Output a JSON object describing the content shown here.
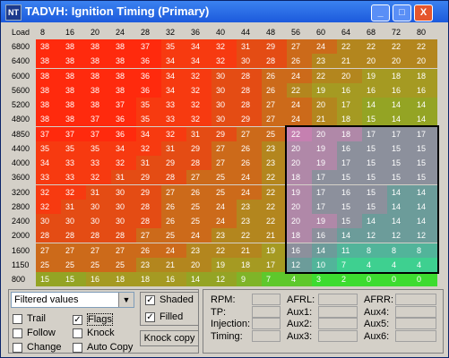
{
  "window": {
    "title": "TADVH: Ignition Timing (Primary)",
    "icon_label": "NT"
  },
  "titlebar_buttons": {
    "minimize": "_",
    "maximize": "□",
    "close": "X"
  },
  "header": {
    "corner": "Load",
    "columns": [
      "8",
      "16",
      "20",
      "24",
      "28",
      "32",
      "36",
      "40",
      "44",
      "48",
      "56",
      "60",
      "64",
      "68",
      "72",
      "80"
    ]
  },
  "rows": [
    {
      "rpm": "6800",
      "values": [
        38,
        38,
        38,
        38,
        37,
        35,
        34,
        32,
        31,
        29,
        27,
        24,
        22,
        22,
        22,
        22
      ]
    },
    {
      "rpm": "6400",
      "values": [
        38,
        38,
        38,
        38,
        36,
        34,
        34,
        32,
        30,
        28,
        26,
        23,
        21,
        20,
        20,
        20
      ]
    },
    {
      "rpm": "6000",
      "values": [
        38,
        38,
        38,
        38,
        36,
        34,
        32,
        30,
        28,
        26,
        24,
        22,
        20,
        19,
        18,
        18
      ]
    },
    {
      "rpm": "5600",
      "values": [
        38,
        38,
        38,
        38,
        36,
        34,
        32,
        30,
        28,
        26,
        22,
        19,
        16,
        16,
        16,
        16
      ]
    },
    {
      "rpm": "5200",
      "values": [
        38,
        38,
        38,
        37,
        35,
        33,
        32,
        30,
        28,
        27,
        24,
        20,
        17,
        14,
        14,
        14
      ]
    },
    {
      "rpm": "4800",
      "values": [
        38,
        38,
        37,
        36,
        35,
        33,
        32,
        30,
        29,
        27,
        24,
        21,
        18,
        15,
        14,
        14
      ]
    },
    {
      "rpm": "4850",
      "values": [
        37,
        37,
        37,
        36,
        34,
        32,
        31,
        29,
        27,
        25,
        22,
        20,
        18,
        17,
        17,
        17
      ]
    },
    {
      "rpm": "4400",
      "values": [
        35,
        35,
        35,
        34,
        32,
        31,
        29,
        27,
        26,
        23,
        20,
        19,
        16,
        15,
        15,
        15
      ]
    },
    {
      "rpm": "4000",
      "values": [
        34,
        33,
        33,
        32,
        31,
        29,
        28,
        27,
        26,
        23,
        20,
        19,
        17,
        15,
        15,
        15
      ]
    },
    {
      "rpm": "3600",
      "values": [
        33,
        33,
        32,
        31,
        29,
        28,
        27,
        25,
        24,
        22,
        18,
        17,
        15,
        15,
        15,
        15
      ]
    },
    {
      "rpm": "3200",
      "values": [
        32,
        32,
        31,
        30,
        29,
        27,
        26,
        25,
        24,
        22,
        19,
        17,
        16,
        15,
        14,
        14
      ]
    },
    {
      "rpm": "2800",
      "values": [
        32,
        31,
        30,
        30,
        28,
        26,
        25,
        24,
        23,
        22,
        20,
        17,
        15,
        15,
        14,
        14
      ]
    },
    {
      "rpm": "2400",
      "values": [
        30,
        30,
        30,
        30,
        28,
        26,
        25,
        24,
        23,
        22,
        20,
        19,
        15,
        14,
        14,
        14
      ]
    },
    {
      "rpm": "2000",
      "values": [
        28,
        28,
        28,
        28,
        27,
        25,
        24,
        23,
        22,
        21,
        18,
        16,
        14,
        12,
        12,
        12
      ]
    },
    {
      "rpm": "1600",
      "values": [
        27,
        27,
        27,
        27,
        26,
        24,
        23,
        22,
        21,
        19,
        16,
        14,
        11,
        8,
        8,
        8
      ]
    },
    {
      "rpm": "1150",
      "values": [
        25,
        25,
        25,
        25,
        23,
        21,
        20,
        19,
        18,
        17,
        12,
        10,
        7,
        4,
        4,
        4
      ]
    },
    {
      "rpm": "800",
      "values": [
        15,
        15,
        16,
        18,
        18,
        16,
        14,
        12,
        9,
        7,
        4,
        3,
        2,
        0,
        0,
        0
      ]
    }
  ],
  "controls": {
    "filter_select": "Filtered values",
    "checkboxes": [
      {
        "label": "Trail",
        "checked": false
      },
      {
        "label": "Follow",
        "checked": false
      },
      {
        "label": "Change",
        "checked": false
      },
      {
        "label": "Flags",
        "checked": true
      },
      {
        "label": "Knock",
        "checked": false
      },
      {
        "label": "Auto Copy",
        "checked": false
      },
      {
        "label": "Shaded",
        "checked": true
      },
      {
        "label": "Filled",
        "checked": true
      }
    ],
    "knock_copy_button": "Knock copy",
    "check_glyph": "✓"
  },
  "readouts": {
    "col1": [
      "RPM:",
      "TP:",
      "Injection:",
      "Timing:"
    ],
    "col2": [
      "AFRL:",
      "Aux1:",
      "Aux2:",
      "Aux3:"
    ],
    "col3": [
      "AFRR:",
      "Aux4:",
      "Aux5:",
      "Aux6:"
    ]
  }
}
